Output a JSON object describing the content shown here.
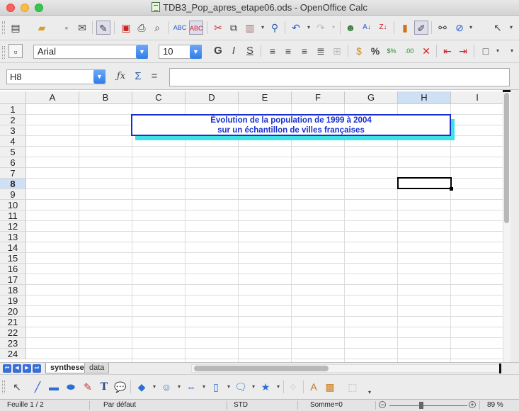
{
  "window": {
    "title": "TDB3_Pop_apres_etape06.ods - OpenOffice Calc"
  },
  "toolbar_standard": {
    "icons": [
      "new-icon",
      "open-icon",
      "save-icon",
      "email-icon",
      "edit-file-icon",
      "export-pdf-icon",
      "print-icon",
      "print-preview-icon",
      "spellcheck-icon",
      "autospellcheck-icon",
      "cut-icon",
      "copy-icon",
      "paste-icon",
      "format-paintbrush-icon",
      "undo-icon",
      "redo-icon",
      "hyperlink-icon",
      "sort-ascending-icon",
      "sort-descending-icon",
      "chart-icon",
      "show-draw-functions-icon",
      "find-replace-icon",
      "navigator-icon",
      "pointer-icon"
    ]
  },
  "toolbar_format": {
    "font_name": "Arial",
    "font_size": "10",
    "bold_label": "G",
    "italic_label": "I",
    "underline_label": "S"
  },
  "formula_bar": {
    "cell_ref": "H8",
    "formula_value": ""
  },
  "grid": {
    "columns": [
      "A",
      "B",
      "C",
      "D",
      "E",
      "F",
      "G",
      "H",
      "I"
    ],
    "selected_column": "H",
    "rows": [
      "1",
      "2",
      "3",
      "4",
      "5",
      "6",
      "7",
      "8",
      "9",
      "10",
      "11",
      "12",
      "13",
      "14",
      "15",
      "16",
      "17",
      "18",
      "19",
      "20",
      "21",
      "22",
      "23",
      "24"
    ],
    "selected_row": "8",
    "title_line1": "Évolution de la population de 1999 à 2004",
    "title_line2": "sur un échantillon de villes françaises"
  },
  "sheet_tabs": [
    {
      "label": "synthese",
      "active": true
    },
    {
      "label": "data",
      "active": false
    }
  ],
  "status_bar": {
    "sheet": "Feuille 1 / 2",
    "page_style": "Par défaut",
    "mode": "STD",
    "sum": "Somme=0",
    "zoom": "89 %"
  },
  "colors": {
    "title_text": "#1a2fd0",
    "title_shadow": "#40e0e8",
    "selected_header": "#cfe0f5"
  }
}
